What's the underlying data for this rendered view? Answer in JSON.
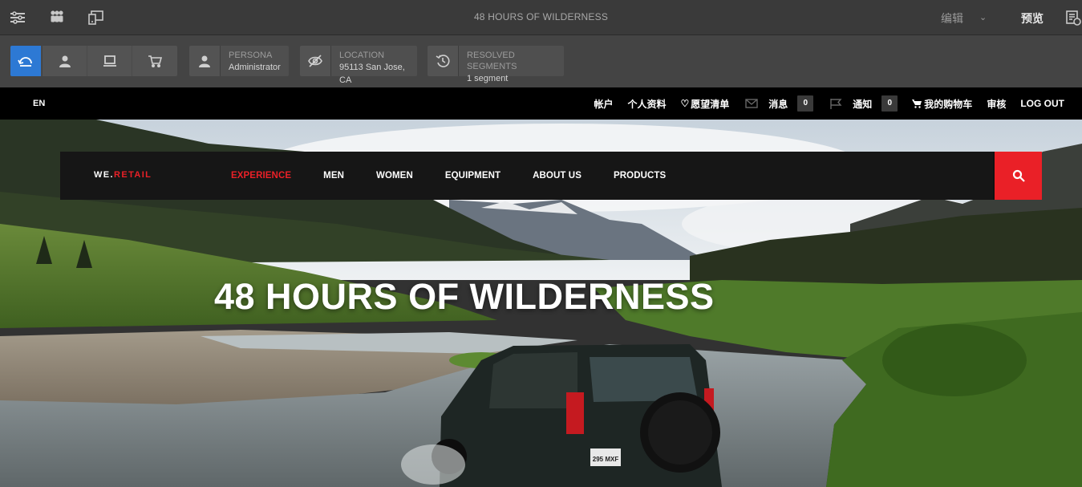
{
  "editor": {
    "page_title": "48 HOURS OF WILDERNESS",
    "mode_edit": "编辑",
    "mode_preview": "预览",
    "tools": [
      "side-panel-icon",
      "people-icon",
      "emulator-icon"
    ]
  },
  "context_hub": {
    "devices": [
      "reset-icon",
      "user-icon",
      "monitor-icon",
      "cart-icon"
    ],
    "persona": {
      "label": "PERSONA",
      "value": "Administrator"
    },
    "location": {
      "label": "LOCATION",
      "value": "95113 San Jose, CA"
    },
    "segments": {
      "label": "RESOLVED SEGMENTS",
      "value": "1 segment"
    }
  },
  "utility": {
    "language": "EN",
    "account": "帐户",
    "profile": "个人资料",
    "wishlist": "愿望清单",
    "messages": "消息",
    "messages_count": "0",
    "notifications": "通知",
    "notifications_count": "0",
    "cart": "我的购物车",
    "review": "审核",
    "logout": "LOG OUT"
  },
  "site": {
    "brand_prefix": "WE.",
    "brand_suffix": "RETAIL",
    "nav": [
      "EXPERIENCE",
      "MEN",
      "WOMEN",
      "EQUIPMENT",
      "ABOUT US",
      "PRODUCTS"
    ],
    "active_nav": "EXPERIENCE",
    "hero_title": "48 HOURS OF WILDERNESS",
    "plate": "295 MXF"
  },
  "colors": {
    "accent_blue": "#2d79d4",
    "brand_red": "#ea2027"
  }
}
